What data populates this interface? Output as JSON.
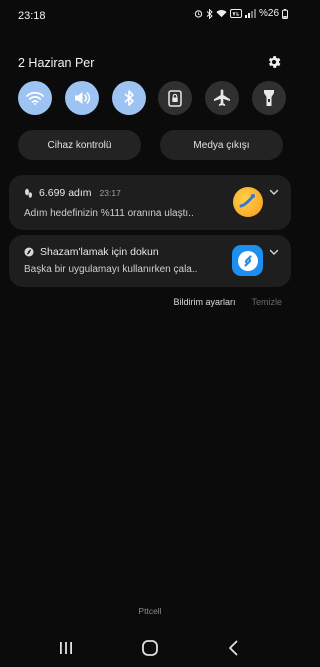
{
  "status_bar": {
    "time": "23:18",
    "battery_text": "%26"
  },
  "panel": {
    "date": "2 Haziran Per",
    "quick_toggles": [
      {
        "name": "wifi",
        "on": true
      },
      {
        "name": "sound",
        "on": true
      },
      {
        "name": "bluetooth",
        "on": true
      },
      {
        "name": "portrait-lock",
        "on": false
      },
      {
        "name": "airplane-mode",
        "on": false
      },
      {
        "name": "flashlight",
        "on": false
      }
    ],
    "device_control_label": "Cihaz kontrolü",
    "media_output_label": "Medya çıkışı"
  },
  "notifications": [
    {
      "title": "6.699 adım",
      "time": "23:17",
      "body": "Adım hedefinizin %111 oranına ulaştı.."
    },
    {
      "title": "Shazam'lamak için dokun",
      "body": "Başka bir uygulamayı kullanırken çala.."
    }
  ],
  "notification_actions": {
    "settings_label": "Bildirim ayarları",
    "clear_label": "Temizle"
  },
  "carrier": "Pttcell",
  "colors": {
    "background": "#0b0b0b",
    "toggle_on": "#9cc3f1",
    "toggle_off": "#303030",
    "card": "#1e1e1e"
  }
}
